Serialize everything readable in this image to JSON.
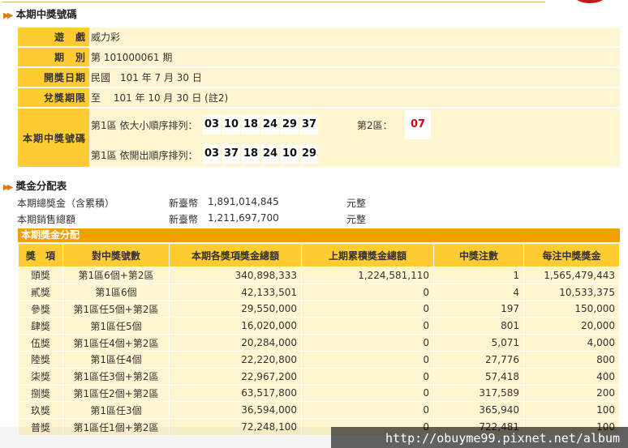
{
  "draw_section": {
    "title": "本期中獎號碼",
    "rows": [
      {
        "label": "遊　戲",
        "value": "威力彩"
      },
      {
        "label": "期　別",
        "value": "第 101000061 期"
      },
      {
        "label": "開獎日期",
        "value": "民國　101 年 7 月 30 日"
      },
      {
        "label": "兌獎期限",
        "value": "至　 101 年 10 月 30 日 (註2)"
      }
    ],
    "numbers_label": "本期中獎號碼",
    "by_size_label": "第1區 依大小順序排列：",
    "by_size": [
      "03",
      "10",
      "18",
      "24",
      "29",
      "37"
    ],
    "zone2_label": "第2區：",
    "zone2": "07",
    "by_order_label": "第1區 依開出順序排列：",
    "by_order": [
      "03",
      "37",
      "18",
      "24",
      "10",
      "29"
    ]
  },
  "distribution": {
    "title": "獎金分配表",
    "lines": [
      {
        "label": "本期總獎金（含累積）",
        "currency": "新臺幣",
        "amount": "1,891,014,845",
        "unit": "元整"
      },
      {
        "label": "本期銷售總額",
        "currency": "新臺幣",
        "amount": "1,211,697,700",
        "unit": "元整"
      }
    ]
  },
  "prize_table": {
    "title": "本期獎金分配",
    "headers": [
      "獎　項",
      "對中獎號數",
      "本期各獎項獎金總額",
      "上期累積獎金總額",
      "中獎注數",
      "每注中獎獎金"
    ],
    "rows": [
      [
        "頭獎",
        "第1區6個+第2區",
        "340,898,333",
        "1,224,581,110",
        "1",
        "1,565,479,443"
      ],
      [
        "貳獎",
        "第1區6個",
        "42,133,501",
        "0",
        "4",
        "10,533,375"
      ],
      [
        "參獎",
        "第1區任5個+第2區",
        "29,550,000",
        "0",
        "197",
        "150,000"
      ],
      [
        "肆獎",
        "第1區任5個",
        "16,020,000",
        "0",
        "801",
        "20,000"
      ],
      [
        "伍獎",
        "第1區任4個+第2區",
        "20,284,000",
        "0",
        "5,071",
        "4,000"
      ],
      [
        "陸獎",
        "第1區任4個",
        "22,220,800",
        "0",
        "27,776",
        "800"
      ],
      [
        "柒獎",
        "第1區任3個+第2區",
        "22,967,200",
        "0",
        "57,418",
        "400"
      ],
      [
        "捌獎",
        "第1區任2個+第2區",
        "63,517,800",
        "0",
        "317,589",
        "200"
      ],
      [
        "玖獎",
        "第1區任3個",
        "36,594,000",
        "0",
        "365,940",
        "100"
      ],
      [
        "普獎",
        "第1區任1個+第2區",
        "72,248,100",
        "0",
        "722,481",
        "100"
      ]
    ]
  },
  "watermark": "http://obuyme99.pixnet.net/album"
}
